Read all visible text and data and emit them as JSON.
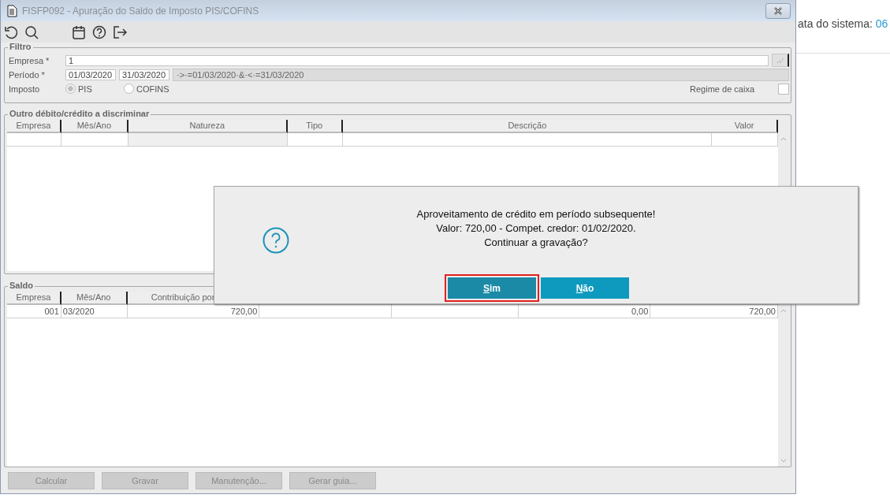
{
  "window": {
    "title": "FISFP092 - Apuração do Saldo de Imposto PIS/COFINS"
  },
  "toolbar": [
    {
      "kind": "undo"
    },
    {
      "kind": "search"
    },
    {
      "kind": "calendar"
    },
    {
      "kind": "help"
    },
    {
      "kind": "exit"
    }
  ],
  "filter": {
    "title": "Filtro",
    "empresa": {
      "label": "Empresa *",
      "value": "1"
    },
    "periodo": {
      "label": "Período *",
      "start": "01/03/2020",
      "end": "31/03/2020",
      "expression": "·>·=01/03/2020·&·<·=31/03/2020"
    },
    "imposto": {
      "label": "Imposto",
      "options": [
        {
          "label": "PIS",
          "selected": true
        },
        {
          "label": "COFINS",
          "selected": false
        }
      ]
    },
    "regime": {
      "label": "Regime de caixa",
      "checked": false
    }
  },
  "outro": {
    "title": "Outro débito/crédito a discriminar",
    "columns": [
      "Empresa",
      "Mês/Ano",
      "Natureza",
      "Tipo",
      "Descrição",
      "Valor"
    ]
  },
  "saldo": {
    "title": "Saldo",
    "columns": [
      "Empresa",
      "Mês/Ano",
      "Contribuição por"
    ],
    "rows": [
      [
        "001",
        "03/2020",
        "720,00",
        null,
        null,
        "0,00",
        "720,00"
      ]
    ]
  },
  "buttons": [
    {
      "label": "Calcular",
      "disabled": true
    },
    {
      "label": "Gravar",
      "disabled": true
    },
    {
      "label": "Manutenção...",
      "disabled": true
    },
    {
      "label": "Gerar guia...",
      "disabled": true
    }
  ],
  "dialog": {
    "lines": [
      "Aproveitamento de crédito em período subsequente!",
      "Valor: 720,00 - Compet. credor: 01/02/2020.",
      "Continuar a gravação?"
    ],
    "buttons": [
      {
        "label": "Sim",
        "selected": true
      },
      {
        "label": "Não",
        "selected": false
      }
    ]
  },
  "background_page": {
    "label": "ata do sistema: ",
    "value": "06"
  }
}
